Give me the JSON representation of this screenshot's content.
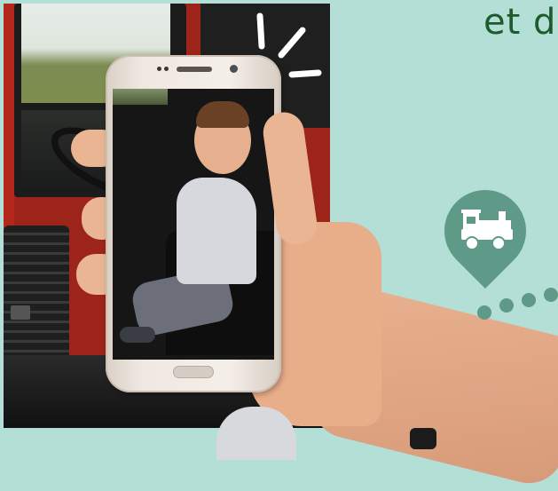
{
  "headline": {
    "text": "et d"
  },
  "pin": {
    "color": "#5e9a87",
    "icon": "train-icon"
  },
  "colors": {
    "background": "#b3dfd6",
    "headline": "#1e5b2c",
    "pin": "#5e9a87"
  }
}
